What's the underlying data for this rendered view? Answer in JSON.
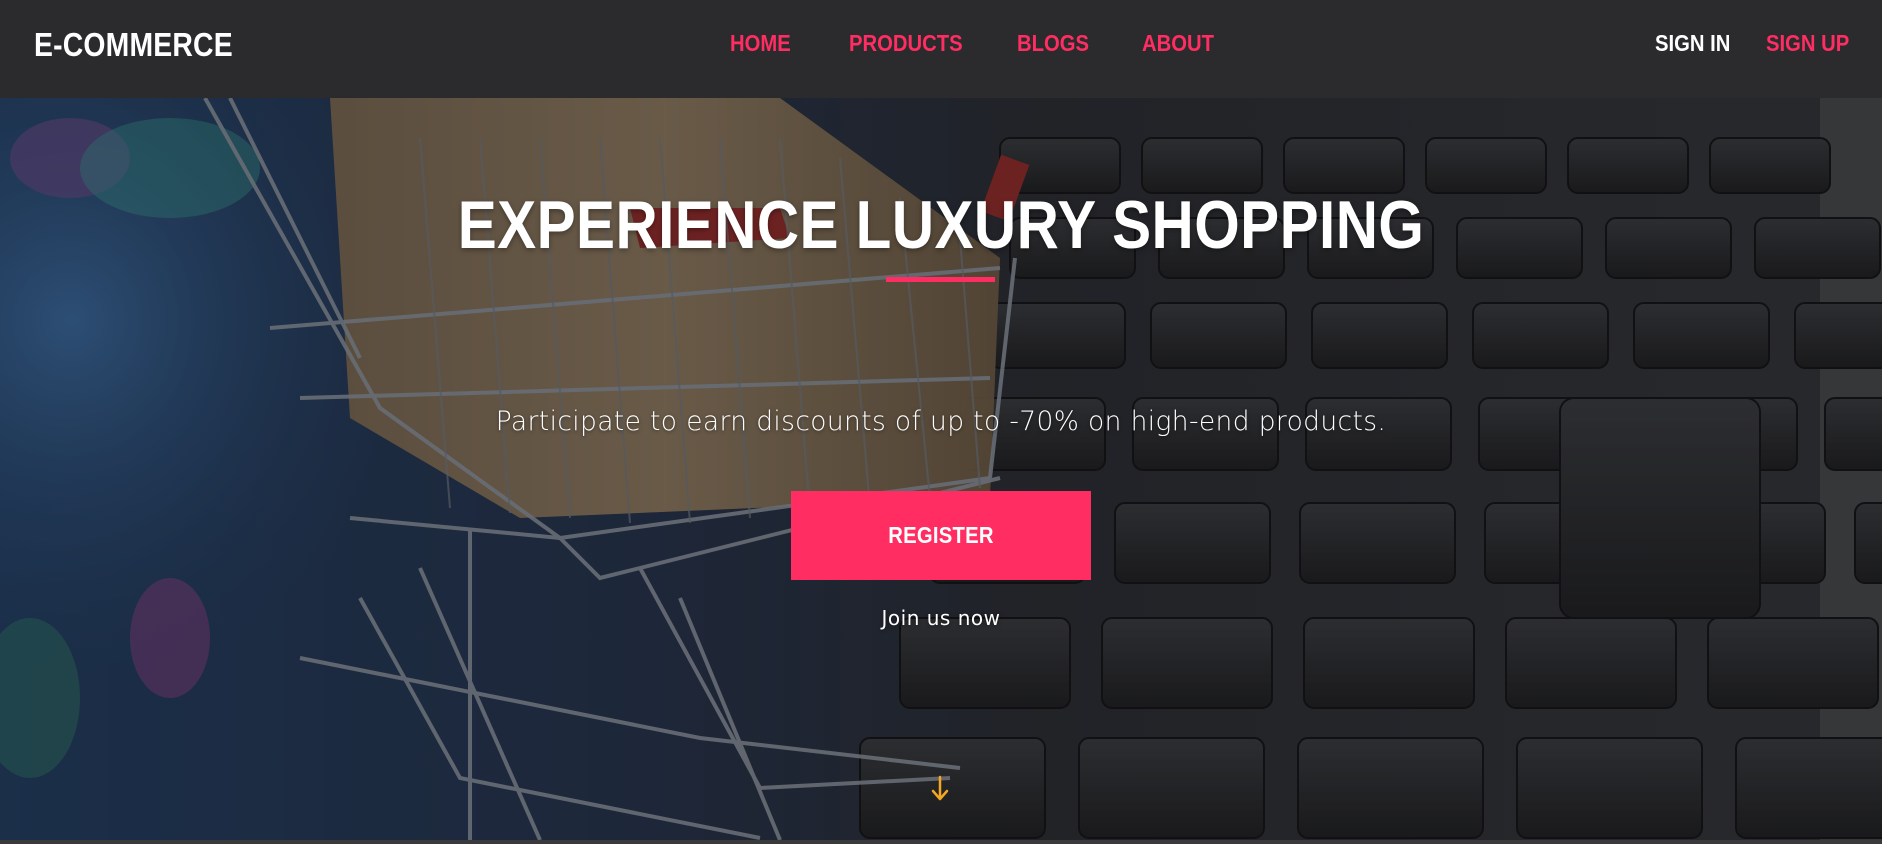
{
  "brand": {
    "name": "E-COMMERCE"
  },
  "nav": {
    "links": [
      {
        "label": "HOME"
      },
      {
        "label": "PRODUCTS"
      },
      {
        "label": "BLOGS"
      },
      {
        "label": "ABOUT"
      }
    ],
    "auth": {
      "sign_in": "SIGN IN",
      "sign_up": "SIGN UP"
    }
  },
  "hero": {
    "title": "EXPERIENCE LUXURY SHOPPING",
    "subtitle": "Participate to earn discounts of up to -70% on high-end products.",
    "cta_label": "REGISTER",
    "cta_caption": "Join us now",
    "scroll_icon": "arrow-down-icon",
    "background": "shopping-cart-on-laptop-keyboard-photo"
  },
  "colors": {
    "accent": "#ff2d62",
    "navbar_bg": "#2b2b2e",
    "text_light": "#ffffff",
    "scroll_arrow": "#f5a623"
  }
}
